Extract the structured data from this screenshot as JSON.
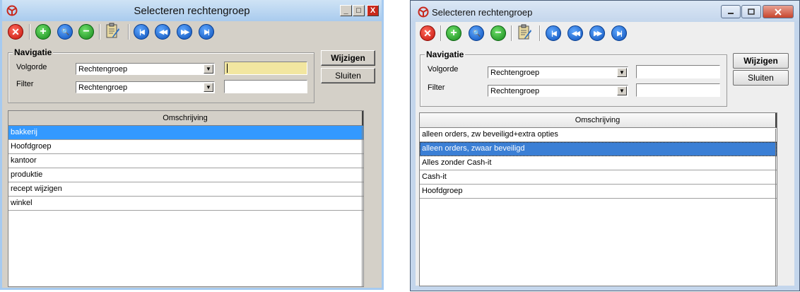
{
  "left_window": {
    "title": "Selecteren rechtengroep",
    "minimize_label": "_",
    "maximize_label": "□",
    "close_label": "X",
    "group_title": "Navigatie",
    "volgorde_label": "Volgorde",
    "filter_label": "Filter",
    "volgorde_value": "Rechtengroep",
    "filter_value": "Rechtengroep",
    "wijzigen_label": "Wijzigen",
    "sluiten_label": "Sluiten",
    "column_header": "Omschrijving",
    "rows": [
      "bakkerij",
      "Hoofdgroep",
      "kantoor",
      "produktie",
      "recept wijzigen",
      "winkel"
    ],
    "selected_row": 0
  },
  "right_window": {
    "title": "Selecteren rechtengroep",
    "group_title": "Navigatie",
    "volgorde_label": "Volgorde",
    "filter_label": "Filter",
    "volgorde_value": "Rechtengroep",
    "filter_value": "Rechtengroep",
    "wijzigen_label": "Wijzigen",
    "sluiten_label": "Sluiten",
    "column_header": "Omschrijving",
    "rows": [
      "alleen orders, zw beveiligd+extra opties",
      "alleen orders, zwaar beveiligd",
      "Alles zonder Cash-it",
      "Cash-it",
      "Hoofdgroep"
    ],
    "selected_row": 1
  },
  "toolbar_icons": [
    "delete-icon",
    "add-icon",
    "search-icon",
    "remove-icon",
    "clipboard-icon",
    "first-record-icon",
    "previous-record-icon",
    "next-record-icon",
    "last-record-icon"
  ]
}
